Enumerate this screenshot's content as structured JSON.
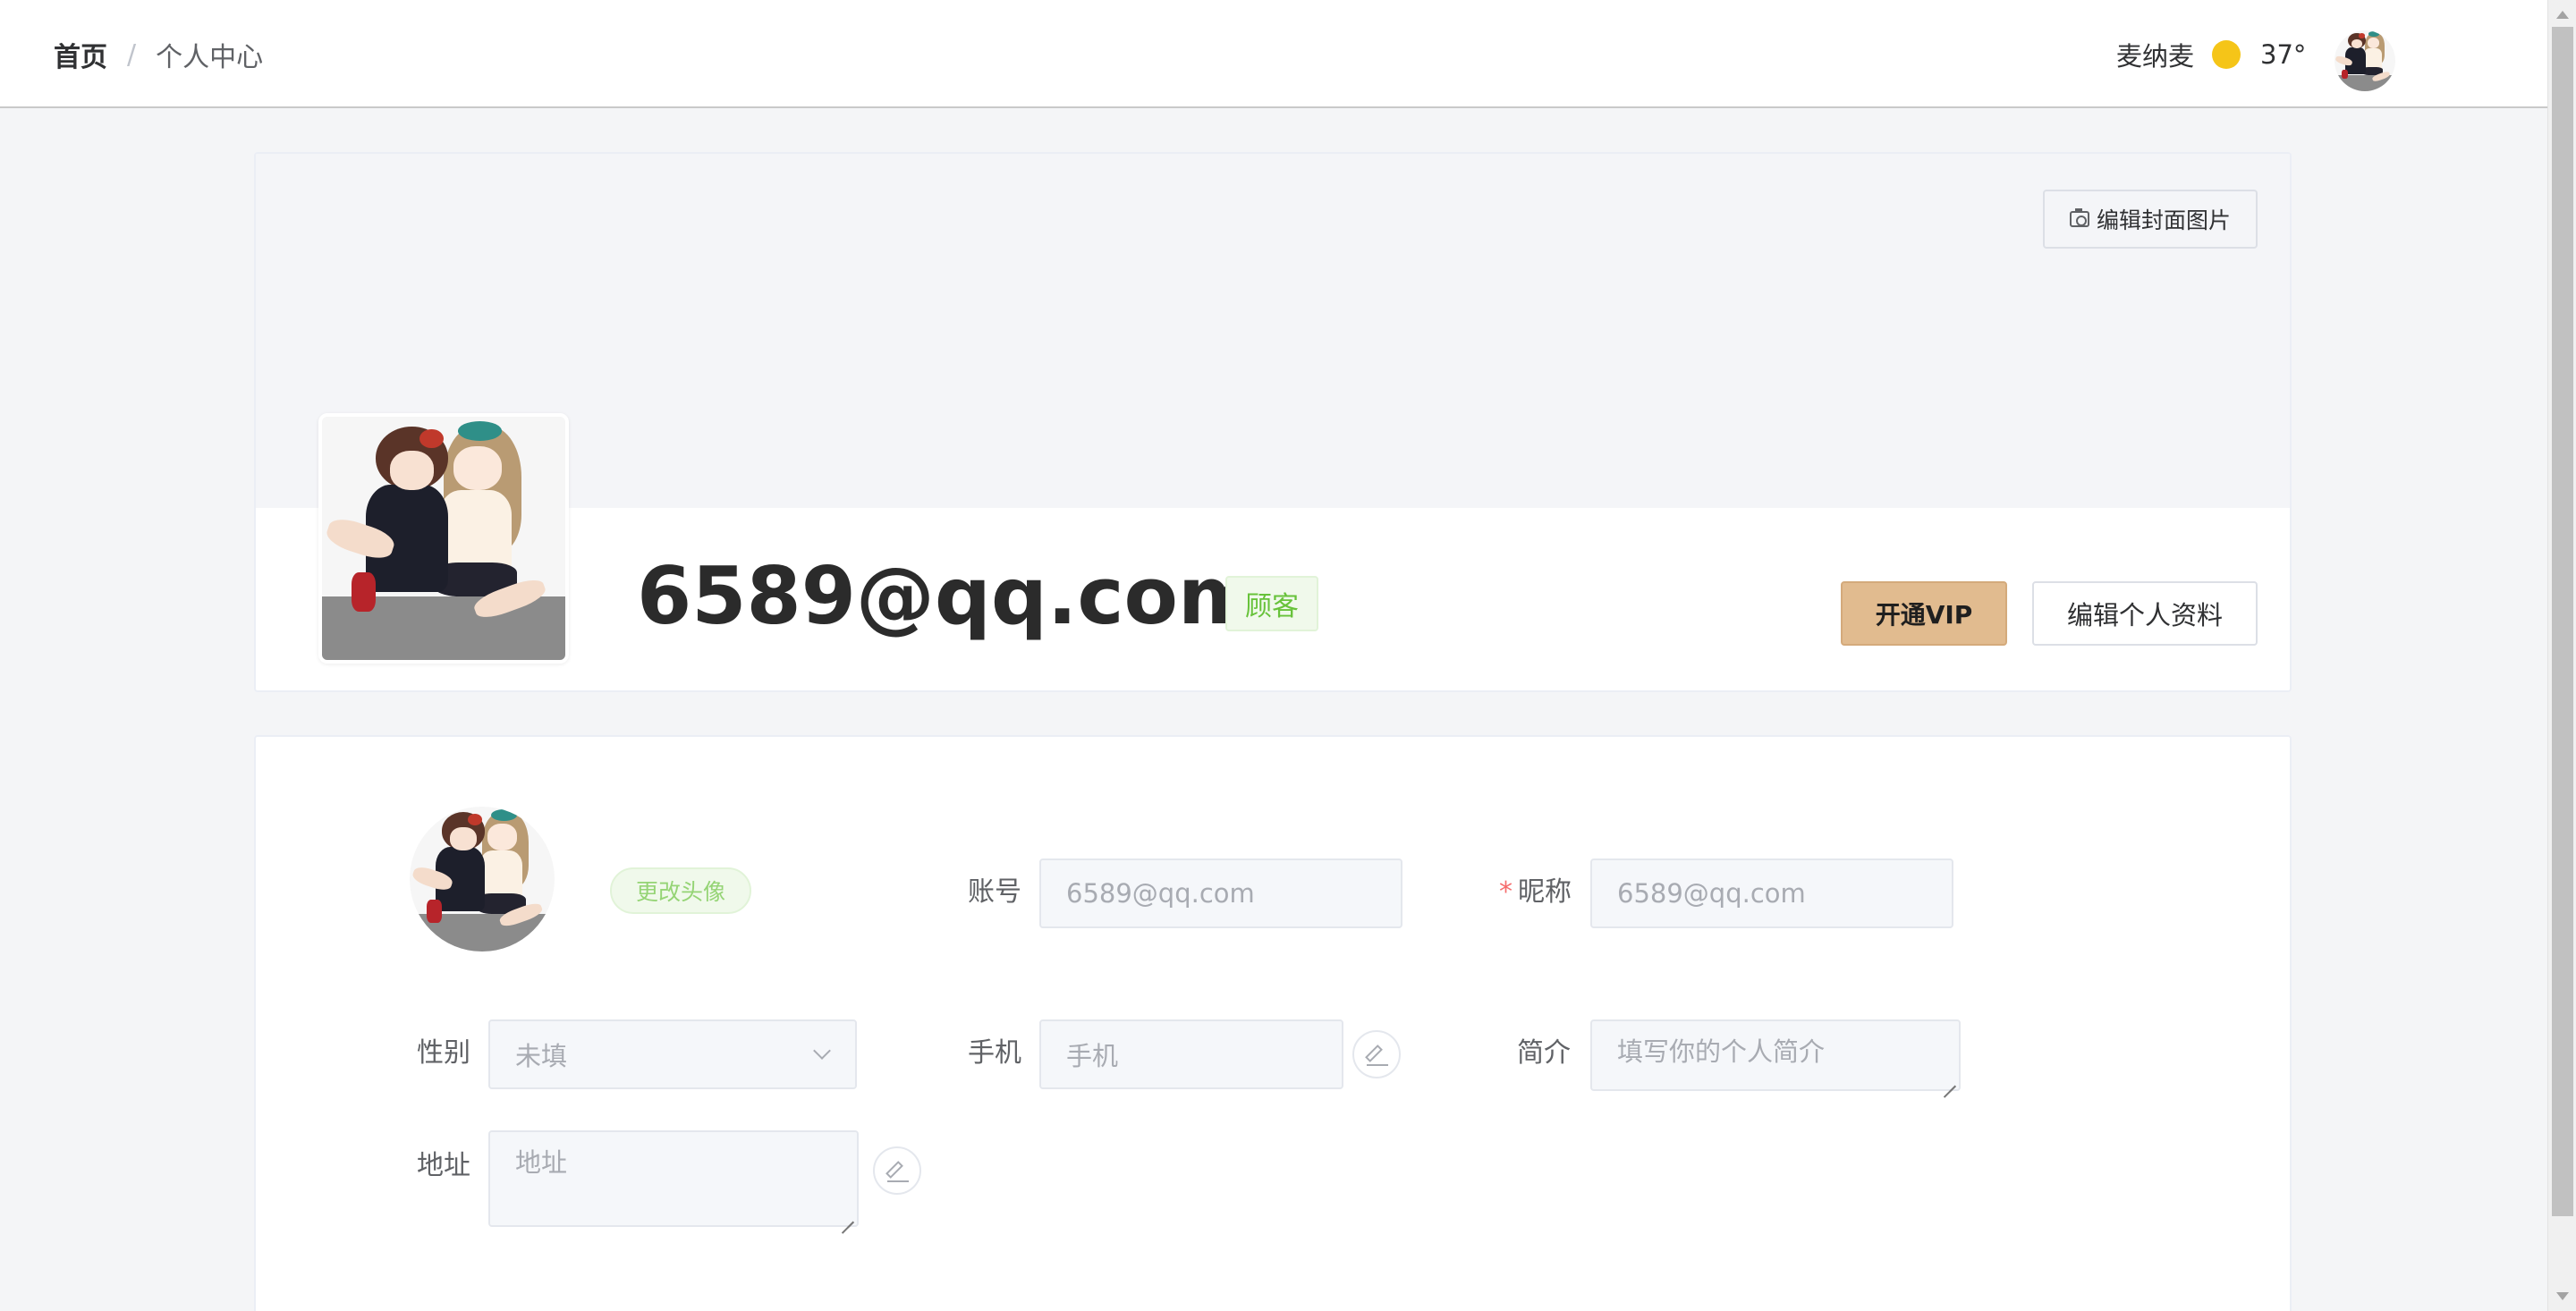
{
  "header": {
    "breadcrumb_home": "首页",
    "breadcrumb_separator": "/",
    "breadcrumb_current": "个人中心",
    "city": "麦纳麦",
    "weather_icon": "sun-icon",
    "temperature": "37°"
  },
  "profile": {
    "edit_cover_label": "编辑封面图片",
    "name": "6589@qq.com",
    "role_tag": "顾客",
    "vip_button": "开通VIP",
    "edit_profile_button": "编辑个人资料"
  },
  "form": {
    "change_avatar_button": "更改头像",
    "account_label": "账号",
    "account_value": "6589@qq.com",
    "nickname_required_mark": "*",
    "nickname_label": "昵称",
    "nickname_value": "6589@qq.com",
    "gender_label": "性别",
    "gender_value": "未填",
    "phone_label": "手机",
    "phone_placeholder": "手机",
    "bio_label": "简介",
    "bio_placeholder": "填写你的个人简介",
    "address_label": "地址",
    "address_placeholder": "地址"
  },
  "colors": {
    "vip_button_bg": "#e1bb8f",
    "role_tag_text": "#67c23a",
    "required_mark": "#f56c6c",
    "sun": "#f5c518"
  }
}
